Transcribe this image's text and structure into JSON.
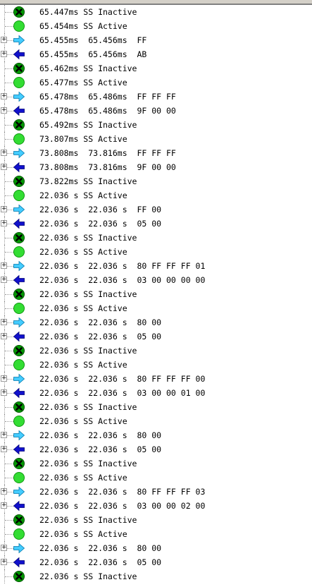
{
  "colors": {
    "inactive_icon": "#009900",
    "active_icon": "#33dd33",
    "mosi_arrow": "#44ccff",
    "miso_arrow": "#1111cc"
  },
  "rows": [
    {
      "icon": "inactive-icon",
      "expandable": false,
      "text": "65.447ms SS Inactive"
    },
    {
      "icon": "active-icon",
      "expandable": false,
      "text": "65.454ms SS Active"
    },
    {
      "icon": "right-arrow-icon",
      "expandable": true,
      "text": "65.455ms  65.456ms  FF"
    },
    {
      "icon": "left-arrow-icon",
      "expandable": true,
      "text": "65.455ms  65.456ms  AB"
    },
    {
      "icon": "inactive-icon",
      "expandable": false,
      "text": "65.462ms SS Inactive"
    },
    {
      "icon": "active-icon",
      "expandable": false,
      "text": "65.477ms SS Active"
    },
    {
      "icon": "right-arrow-icon",
      "expandable": true,
      "text": "65.478ms  65.486ms  FF FF FF"
    },
    {
      "icon": "left-arrow-icon",
      "expandable": true,
      "text": "65.478ms  65.486ms  9F 00 00"
    },
    {
      "icon": "inactive-icon",
      "expandable": false,
      "text": "65.492ms SS Inactive"
    },
    {
      "icon": "active-icon",
      "expandable": false,
      "text": "73.807ms SS Active"
    },
    {
      "icon": "right-arrow-icon",
      "expandable": true,
      "text": "73.808ms  73.816ms  FF FF FF"
    },
    {
      "icon": "left-arrow-icon",
      "expandable": true,
      "text": "73.808ms  73.816ms  9F 00 00"
    },
    {
      "icon": "inactive-icon",
      "expandable": false,
      "text": "73.822ms SS Inactive"
    },
    {
      "icon": "active-icon",
      "expandable": false,
      "text": "22.036 s SS Active"
    },
    {
      "icon": "right-arrow-icon",
      "expandable": true,
      "text": "22.036 s  22.036 s  FF 00"
    },
    {
      "icon": "left-arrow-icon",
      "expandable": true,
      "text": "22.036 s  22.036 s  05 00"
    },
    {
      "icon": "inactive-icon",
      "expandable": false,
      "text": "22.036 s SS Inactive"
    },
    {
      "icon": "active-icon",
      "expandable": false,
      "text": "22.036 s SS Active"
    },
    {
      "icon": "right-arrow-icon",
      "expandable": true,
      "text": "22.036 s  22.036 s  80 FF FF FF 01"
    },
    {
      "icon": "left-arrow-icon",
      "expandable": true,
      "text": "22.036 s  22.036 s  03 00 00 00 00"
    },
    {
      "icon": "inactive-icon",
      "expandable": false,
      "text": "22.036 s SS Inactive"
    },
    {
      "icon": "active-icon",
      "expandable": false,
      "text": "22.036 s SS Active"
    },
    {
      "icon": "right-arrow-icon",
      "expandable": true,
      "text": "22.036 s  22.036 s  80 00"
    },
    {
      "icon": "left-arrow-icon",
      "expandable": true,
      "text": "22.036 s  22.036 s  05 00"
    },
    {
      "icon": "inactive-icon",
      "expandable": false,
      "text": "22.036 s SS Inactive"
    },
    {
      "icon": "active-icon",
      "expandable": false,
      "text": "22.036 s SS Active"
    },
    {
      "icon": "right-arrow-icon",
      "expandable": true,
      "text": "22.036 s  22.036 s  80 FF FF FF 00"
    },
    {
      "icon": "left-arrow-icon",
      "expandable": true,
      "text": "22.036 s  22.036 s  03 00 00 01 00"
    },
    {
      "icon": "inactive-icon",
      "expandable": false,
      "text": "22.036 s SS Inactive"
    },
    {
      "icon": "active-icon",
      "expandable": false,
      "text": "22.036 s SS Active"
    },
    {
      "icon": "right-arrow-icon",
      "expandable": true,
      "text": "22.036 s  22.036 s  80 00"
    },
    {
      "icon": "left-arrow-icon",
      "expandable": true,
      "text": "22.036 s  22.036 s  05 00"
    },
    {
      "icon": "inactive-icon",
      "expandable": false,
      "text": "22.036 s SS Inactive"
    },
    {
      "icon": "active-icon",
      "expandable": false,
      "text": "22.036 s SS Active"
    },
    {
      "icon": "right-arrow-icon",
      "expandable": true,
      "text": "22.036 s  22.036 s  80 FF FF FF 03"
    },
    {
      "icon": "left-arrow-icon",
      "expandable": true,
      "text": "22.036 s  22.036 s  03 00 00 02 00"
    },
    {
      "icon": "inactive-icon",
      "expandable": false,
      "text": "22.036 s SS Inactive"
    },
    {
      "icon": "active-icon",
      "expandable": false,
      "text": "22.036 s SS Active"
    },
    {
      "icon": "right-arrow-icon",
      "expandable": true,
      "text": "22.036 s  22.036 s  80 00"
    },
    {
      "icon": "left-arrow-icon",
      "expandable": true,
      "text": "22.036 s  22.036 s  05 00"
    },
    {
      "icon": "inactive-icon",
      "expandable": false,
      "text": "22.036 s SS Inactive"
    }
  ]
}
